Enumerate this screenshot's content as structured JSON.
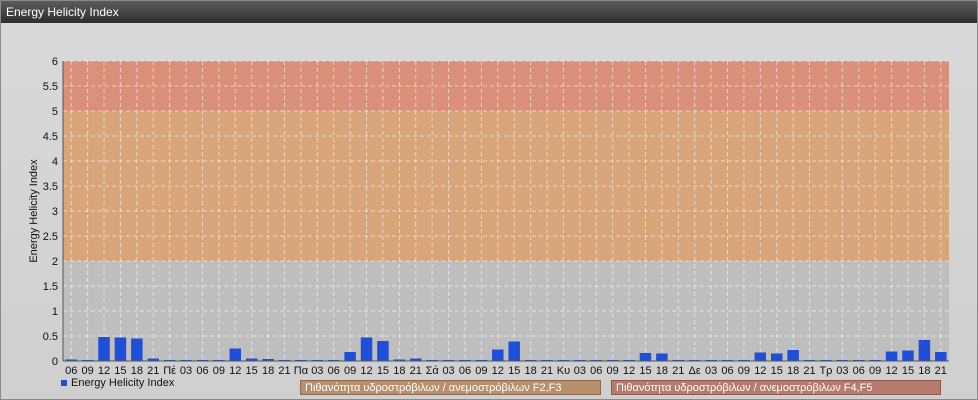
{
  "window": {
    "title": "Energy Helicity Index"
  },
  "colors": {
    "band_low": "#bdbdbd",
    "band_mid": "#d9a070",
    "band_high": "#dc8a72",
    "bar": "#1f4fd8",
    "band_mid_legend": "#b78f6a",
    "band_high_legend": "#b67b6c"
  },
  "legend": {
    "series_label": "Energy Helicity Index",
    "band_mid_label": "Πιθανότητα υδροστρόβιλων / ανεμοστρόβιλων F2,F3",
    "band_high_label": "Πιθανότητα υδροστρόβιλων / ανεμοστρόβιλων F4,F5"
  },
  "chart_data": {
    "type": "bar",
    "ylabel": "Energy Helicity Index",
    "ylim": [
      0,
      6
    ],
    "yticks": [
      "0",
      "0.5",
      "1",
      "1.5",
      "2",
      "2.5",
      "3",
      "3.5",
      "4",
      "4.5",
      "5",
      "5.5",
      "6"
    ],
    "bands": [
      {
        "from": 0,
        "to": 2,
        "label": ""
      },
      {
        "from": 2,
        "to": 5,
        "label": "Πιθανότητα υδροστρόβιλων / ανεμοστρόβιλων F2,F3"
      },
      {
        "from": 5,
        "to": 6,
        "label": "Πιθανότητα υδροστρόβιλων / ανεμοστρόβιλων F4,F5"
      }
    ],
    "categories": [
      "06",
      "09",
      "12",
      "15",
      "18",
      "21",
      "Πέ",
      "03",
      "06",
      "09",
      "12",
      "15",
      "18",
      "21",
      "Πα",
      "03",
      "06",
      "09",
      "12",
      "15",
      "18",
      "21",
      "Σά",
      "03",
      "06",
      "09",
      "12",
      "15",
      "18",
      "21",
      "Κυ",
      "03",
      "06",
      "09",
      "12",
      "15",
      "18",
      "21",
      "Δε",
      "03",
      "06",
      "09",
      "12",
      "15",
      "18",
      "21",
      "Τρ",
      "03",
      "06",
      "09",
      "12",
      "15",
      "18",
      "21"
    ],
    "series": [
      {
        "name": "Energy Helicity Index",
        "values": [
          0.03,
          0.02,
          0.48,
          0.47,
          0.45,
          0.05,
          0.02,
          0.02,
          0.02,
          0.02,
          0.25,
          0.05,
          0.04,
          0.02,
          0.02,
          0.02,
          0.02,
          0.18,
          0.47,
          0.4,
          0.03,
          0.05,
          0.02,
          0.02,
          0.02,
          0.02,
          0.23,
          0.39,
          0.02,
          0.02,
          0.02,
          0.02,
          0.02,
          0.02,
          0.02,
          0.16,
          0.15,
          0.02,
          0.02,
          0.02,
          0.02,
          0.02,
          0.17,
          0.15,
          0.22,
          0.02,
          0.02,
          0.02,
          0.02,
          0.02,
          0.19,
          0.21,
          0.42,
          0.18
        ]
      }
    ],
    "grid": true,
    "legend_position": "bottom"
  }
}
